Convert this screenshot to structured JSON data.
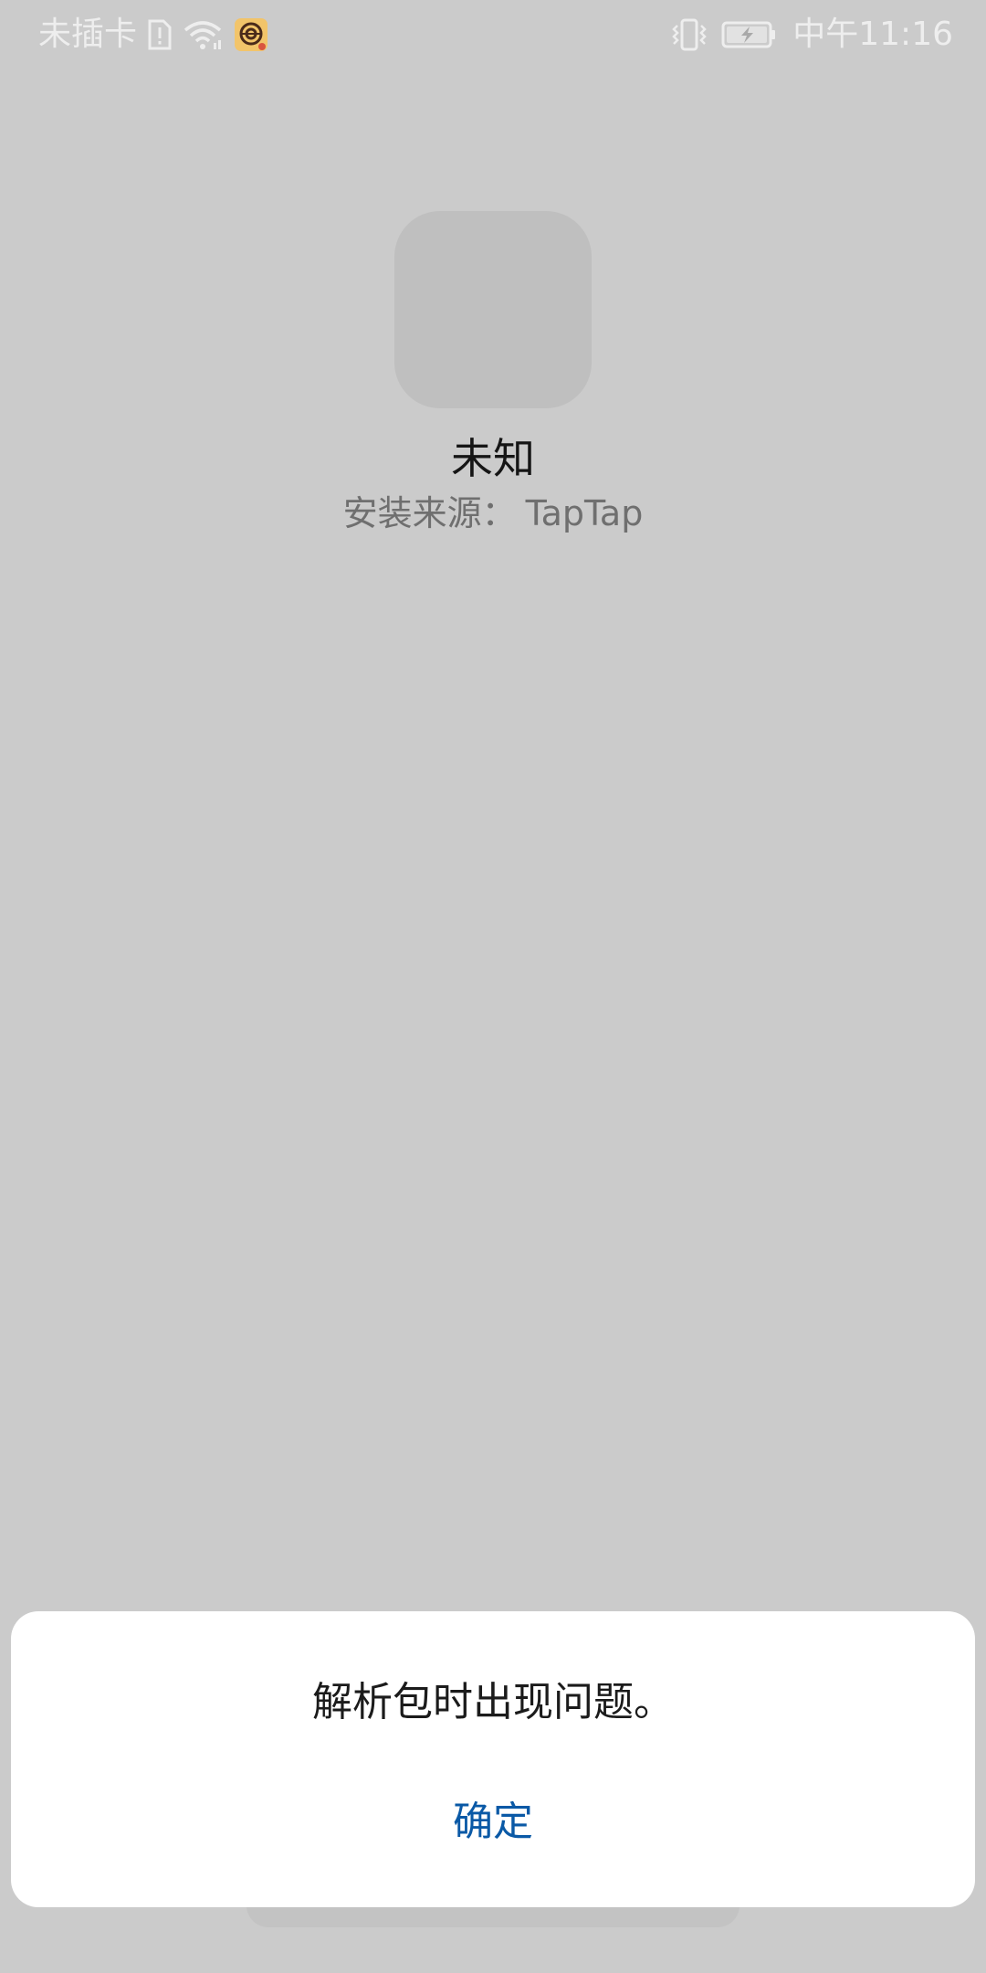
{
  "status_bar": {
    "carrier": "未插卡",
    "time": "中午11:16",
    "icons": [
      "sim-alert-icon",
      "wifi-icon",
      "app-notification-icon",
      "vibrate-icon",
      "battery-charging-icon"
    ]
  },
  "app": {
    "name": "未知",
    "source_label": "安装来源：",
    "source_value": "TapTap"
  },
  "dialog": {
    "message": "解析包时出现问题。",
    "confirm_label": "确定"
  },
  "colors": {
    "background": "#cbcbcb",
    "dialog_background": "#ffffff",
    "accent": "#0a59a6",
    "secondary_text": "#6f6f6f"
  }
}
